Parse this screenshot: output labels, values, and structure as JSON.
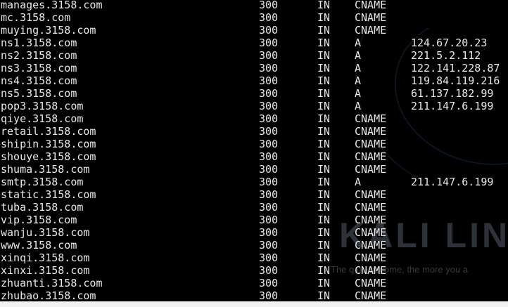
{
  "wallpaper": {
    "title": "KALI LINU",
    "tagline": "The q             ou become, the more you a"
  },
  "records": [
    {
      "name": "manages.3158.com",
      "ttl": "300",
      "class": "IN",
      "type": "CNAME",
      "address": ""
    },
    {
      "name": "mc.3158.com",
      "ttl": "300",
      "class": "IN",
      "type": "CNAME",
      "address": ""
    },
    {
      "name": "muying.3158.com",
      "ttl": "300",
      "class": "IN",
      "type": "CNAME",
      "address": ""
    },
    {
      "name": "ns1.3158.com",
      "ttl": "300",
      "class": "IN",
      "type": "A",
      "address": "124.67.20.23"
    },
    {
      "name": "ns2.3158.com",
      "ttl": "300",
      "class": "IN",
      "type": "A",
      "address": "221.5.2.112"
    },
    {
      "name": "ns3.3158.com",
      "ttl": "300",
      "class": "IN",
      "type": "A",
      "address": "122.141.228.87"
    },
    {
      "name": "ns4.3158.com",
      "ttl": "300",
      "class": "IN",
      "type": "A",
      "address": "119.84.119.216"
    },
    {
      "name": "ns5.3158.com",
      "ttl": "300",
      "class": "IN",
      "type": "A",
      "address": "61.137.182.99"
    },
    {
      "name": "pop3.3158.com",
      "ttl": "300",
      "class": "IN",
      "type": "A",
      "address": "211.147.6.199"
    },
    {
      "name": "qiye.3158.com",
      "ttl": "300",
      "class": "IN",
      "type": "CNAME",
      "address": ""
    },
    {
      "name": "retail.3158.com",
      "ttl": "300",
      "class": "IN",
      "type": "CNAME",
      "address": ""
    },
    {
      "name": "shipin.3158.com",
      "ttl": "300",
      "class": "IN",
      "type": "CNAME",
      "address": ""
    },
    {
      "name": "shouye.3158.com",
      "ttl": "300",
      "class": "IN",
      "type": "CNAME",
      "address": ""
    },
    {
      "name": "shuma.3158.com",
      "ttl": "300",
      "class": "IN",
      "type": "CNAME",
      "address": ""
    },
    {
      "name": "smtp.3158.com",
      "ttl": "300",
      "class": "IN",
      "type": "A",
      "address": "211.147.6.199"
    },
    {
      "name": "static.3158.com",
      "ttl": "300",
      "class": "IN",
      "type": "CNAME",
      "address": ""
    },
    {
      "name": "tuba.3158.com",
      "ttl": "300",
      "class": "IN",
      "type": "CNAME",
      "address": ""
    },
    {
      "name": "vip.3158.com",
      "ttl": "300",
      "class": "IN",
      "type": "CNAME",
      "address": ""
    },
    {
      "name": "wanju.3158.com",
      "ttl": "300",
      "class": "IN",
      "type": "CNAME",
      "address": ""
    },
    {
      "name": "www.3158.com",
      "ttl": "300",
      "class": "IN",
      "type": "CNAME",
      "address": ""
    },
    {
      "name": "xinqi.3158.com",
      "ttl": "300",
      "class": "IN",
      "type": "CNAME",
      "address": ""
    },
    {
      "name": "xinxi.3158.com",
      "ttl": "300",
      "class": "IN",
      "type": "CNAME",
      "address": ""
    },
    {
      "name": "zhuanti.3158.com",
      "ttl": "300",
      "class": "IN",
      "type": "CNAME",
      "address": ""
    },
    {
      "name": "zhubao.3158.com",
      "ttl": "300",
      "class": "IN",
      "type": "CNAME",
      "address": ""
    }
  ]
}
